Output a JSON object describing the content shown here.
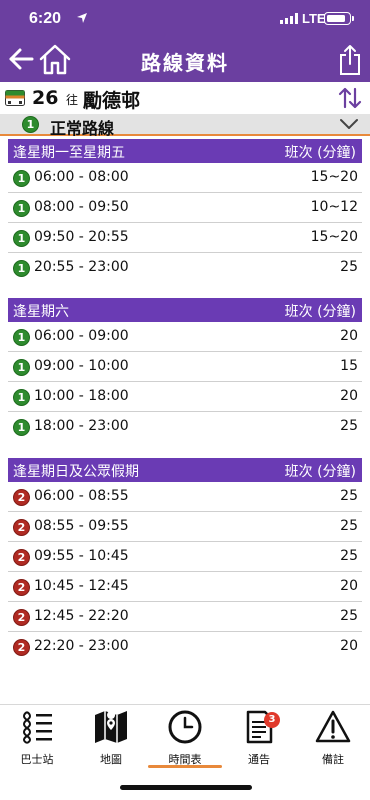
{
  "status_bar": {
    "time": "6:20",
    "network": "LTE"
  },
  "header": {
    "title": "路線資料"
  },
  "route": {
    "number": "26",
    "to_label": "往",
    "destination": "勵德邨"
  },
  "variant": {
    "badge": "1",
    "label": "正常路線"
  },
  "sections": [
    {
      "title": "逢星期一至星期五",
      "freq_header": "班次 (分鐘)",
      "rows": [
        {
          "badge": "1",
          "time": "06:00 - 08:00",
          "freq": "15~20"
        },
        {
          "badge": "1",
          "time": "08:00 - 09:50",
          "freq": "10~12"
        },
        {
          "badge": "1",
          "time": "09:50 - 20:55",
          "freq": "15~20"
        },
        {
          "badge": "1",
          "time": "20:55 - 23:00",
          "freq": "25"
        }
      ]
    },
    {
      "title": "逢星期六",
      "freq_header": "班次 (分鐘)",
      "rows": [
        {
          "badge": "1",
          "time": "06:00 - 09:00",
          "freq": "20"
        },
        {
          "badge": "1",
          "time": "09:00 - 10:00",
          "freq": "15"
        },
        {
          "badge": "1",
          "time": "10:00 - 18:00",
          "freq": "20"
        },
        {
          "badge": "1",
          "time": "18:00 - 23:00",
          "freq": "25"
        }
      ]
    },
    {
      "title": "逢星期日及公眾假期",
      "freq_header": "班次 (分鐘)",
      "rows": [
        {
          "badge": "2",
          "time": "06:00 - 08:55",
          "freq": "25"
        },
        {
          "badge": "2",
          "time": "08:55 - 09:55",
          "freq": "25"
        },
        {
          "badge": "2",
          "time": "09:55 - 10:45",
          "freq": "25"
        },
        {
          "badge": "2",
          "time": "10:45 - 12:45",
          "freq": "20"
        },
        {
          "badge": "2",
          "time": "12:45 - 22:20",
          "freq": "25"
        },
        {
          "badge": "2",
          "time": "22:20 - 23:00",
          "freq": "20"
        }
      ]
    }
  ],
  "tabs": [
    {
      "label": "巴士站",
      "icon": "bus-stops-icon"
    },
    {
      "label": "地圖",
      "icon": "map-icon"
    },
    {
      "label": "時間表",
      "icon": "clock-icon",
      "active": true
    },
    {
      "label": "通告",
      "icon": "notice-icon",
      "badge": "3"
    },
    {
      "label": "備註",
      "icon": "warning-icon"
    }
  ],
  "colors": {
    "header": "#6b3fa0",
    "section_header": "#6a3bb4",
    "accent": "#e8893b",
    "badge_green": "#2e8b2e",
    "badge_red": "#b02a22"
  }
}
